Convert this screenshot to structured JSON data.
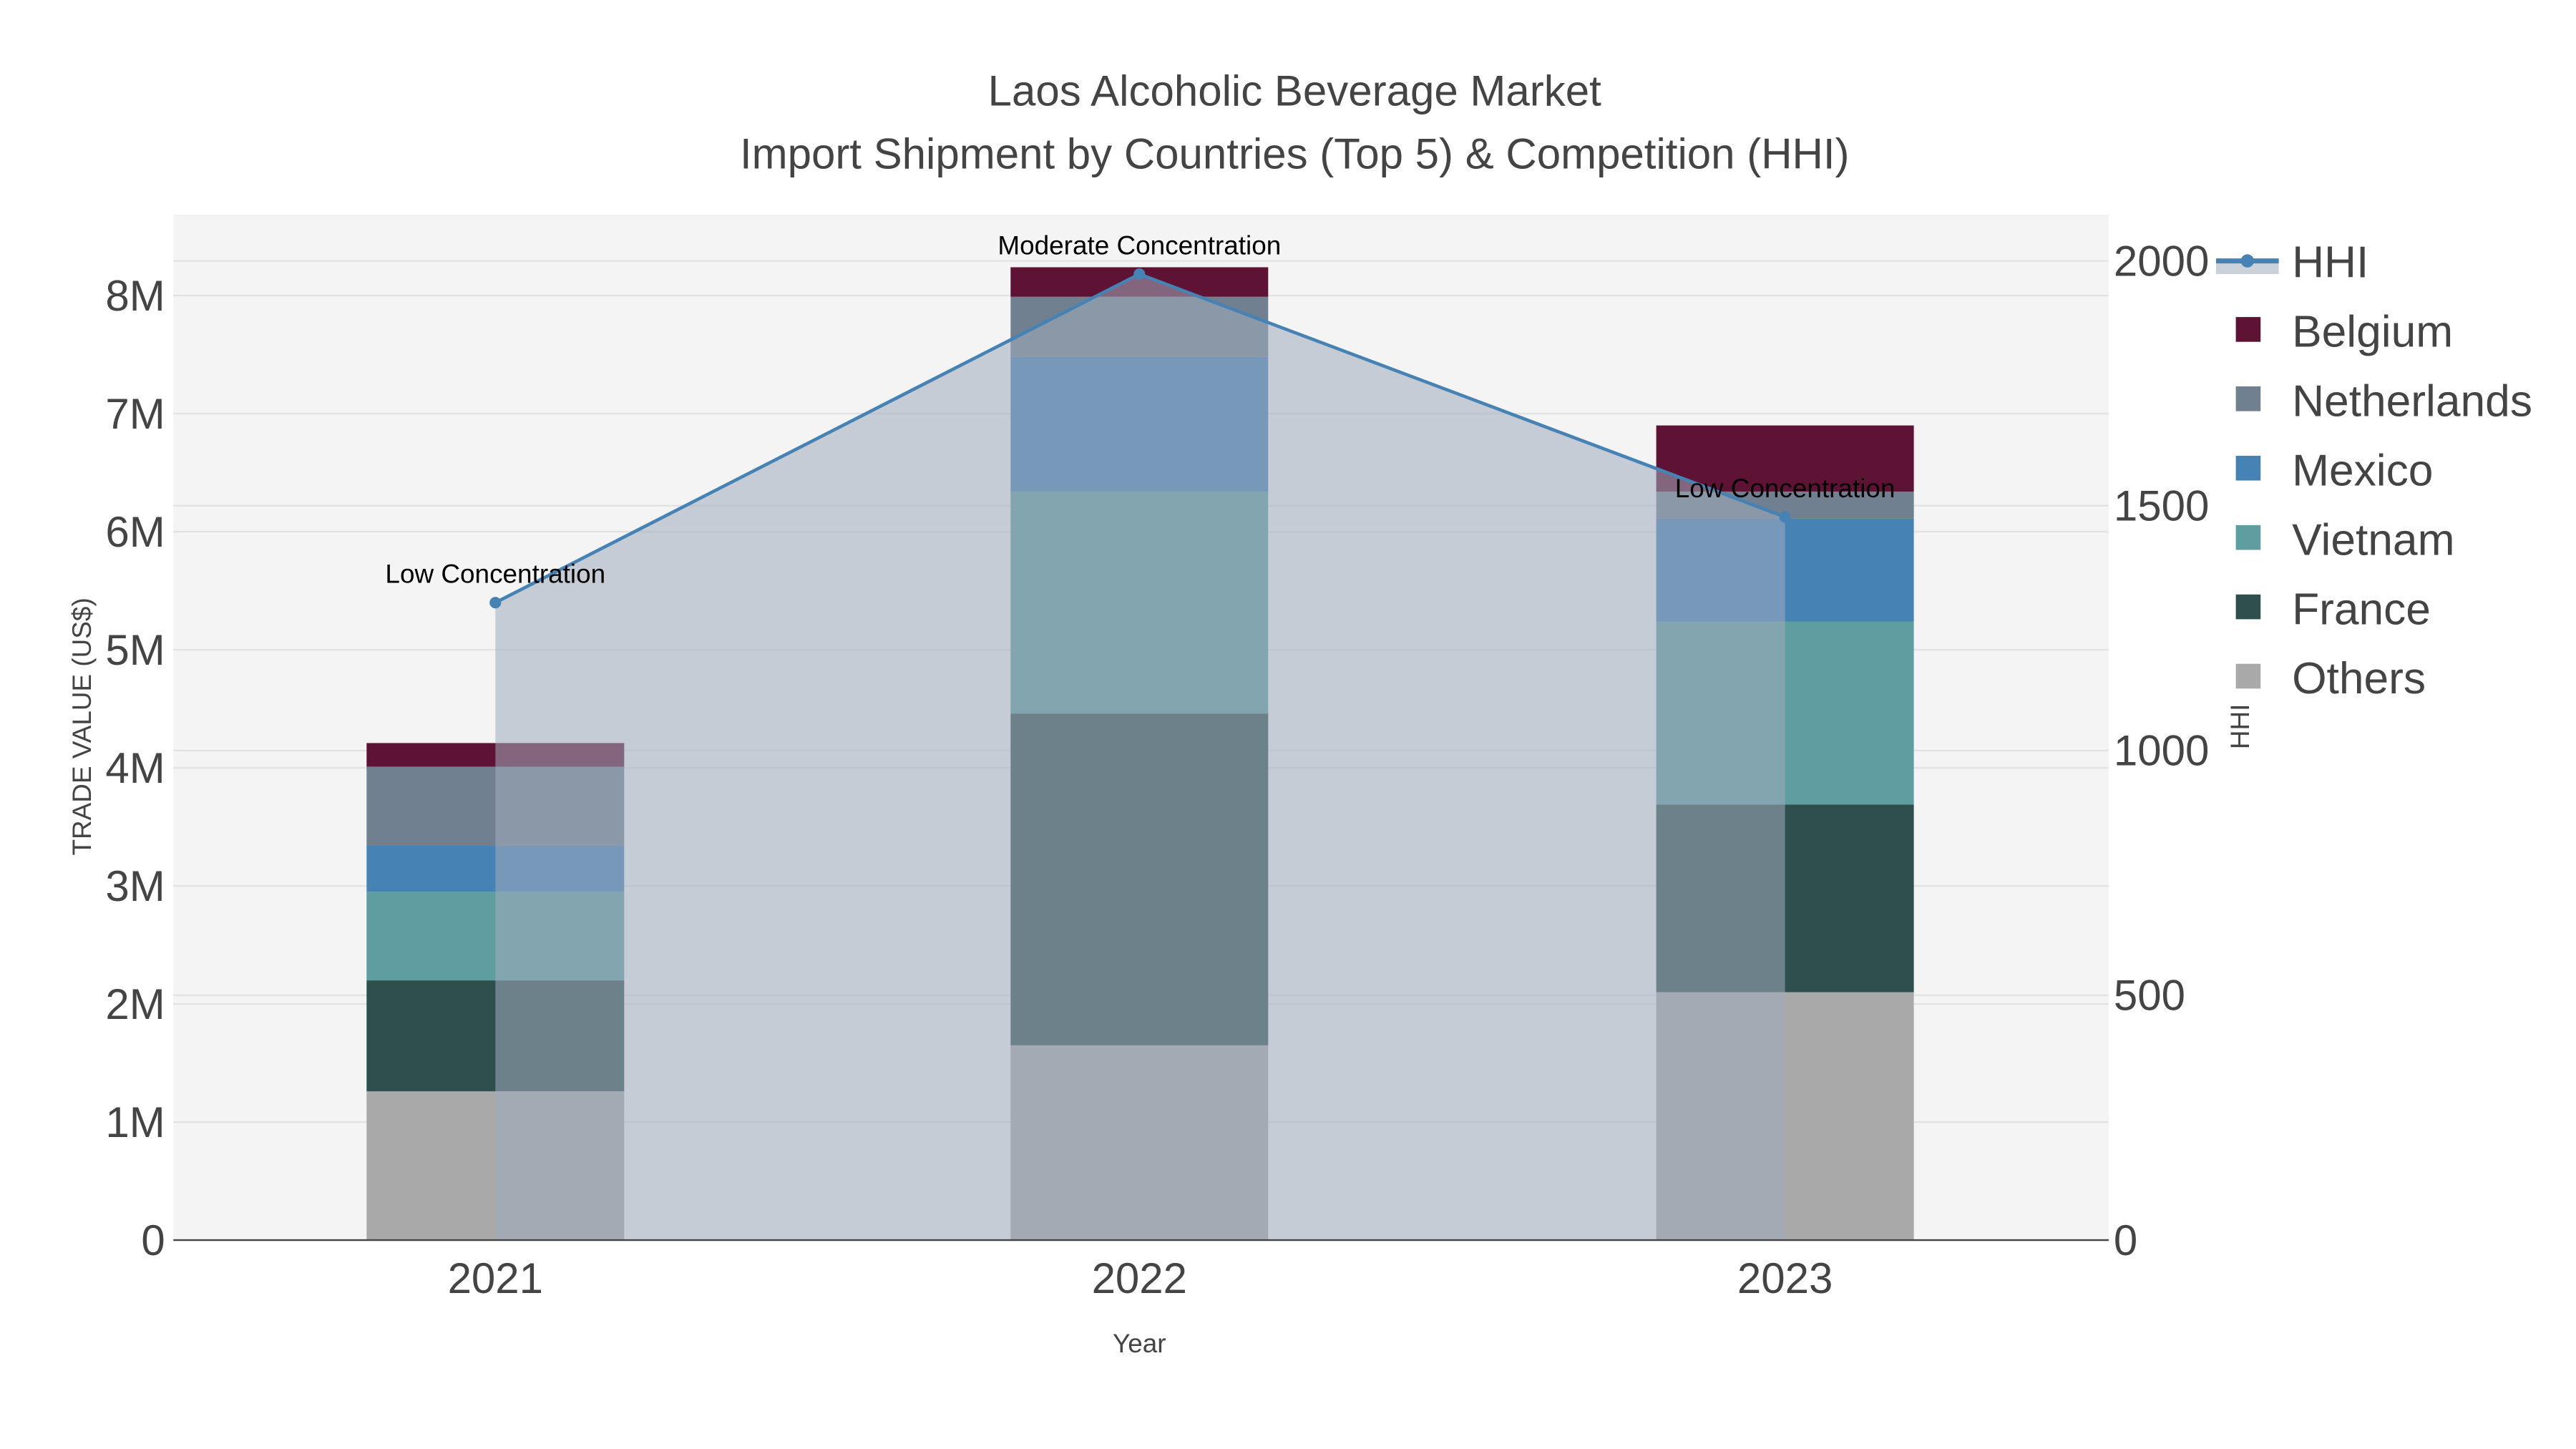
{
  "chart_data": {
    "type": "bar",
    "stacked": true,
    "title": "Laos Alcoholic Beverage Market",
    "subtitle": "Import Shipment by Countries (Top 5) & Competition (HHI)",
    "xlabel": "Year",
    "ylabel": "TRADE VALUE (US$)",
    "y2label": "HHI",
    "categories": [
      "2021",
      "2022",
      "2023"
    ],
    "ylim": [
      0,
      8.7
    ],
    "y_ticks": [
      0,
      1,
      2,
      3,
      4,
      5,
      6,
      7,
      8
    ],
    "y_tick_labels": [
      "0",
      "1M",
      "2M",
      "3M",
      "4M",
      "5M",
      "6M",
      "7M",
      "8M"
    ],
    "y2lim": [
      0,
      2100
    ],
    "y2_ticks": [
      0,
      500,
      1000,
      1500,
      2000
    ],
    "y2_tick_labels": [
      "0",
      "500",
      "1000",
      "1500",
      "2000"
    ],
    "value_unit": "million US$",
    "series": [
      {
        "name": "Others",
        "color": "#a9a9a9",
        "values": [
          1.26,
          1.65,
          2.1
        ]
      },
      {
        "name": "France",
        "color": "#2f4f4f",
        "values": [
          0.94,
          2.81,
          1.59
        ]
      },
      {
        "name": "Vietnam",
        "color": "#5f9ea0",
        "values": [
          0.75,
          1.88,
          1.55
        ]
      },
      {
        "name": "Mexico",
        "color": "#4682b4",
        "values": [
          0.39,
          1.14,
          0.87
        ]
      },
      {
        "name": "Netherlands",
        "color": "#708090",
        "values": [
          0.67,
          0.51,
          0.23
        ]
      },
      {
        "name": "Belgium",
        "color": "#5f1334",
        "values": [
          0.2,
          0.25,
          0.56
        ]
      }
    ],
    "hhi": {
      "name": "HHI",
      "color": "#4682b4",
      "values": [
        1302,
        1973,
        1477
      ]
    },
    "annotations": [
      "Low Concentration",
      "Moderate Concentration",
      "Low Concentration"
    ],
    "legend_order": [
      "HHI",
      "Belgium",
      "Netherlands",
      "Mexico",
      "Vietnam",
      "France",
      "Others"
    ],
    "legend_position": "right",
    "grid": true
  }
}
